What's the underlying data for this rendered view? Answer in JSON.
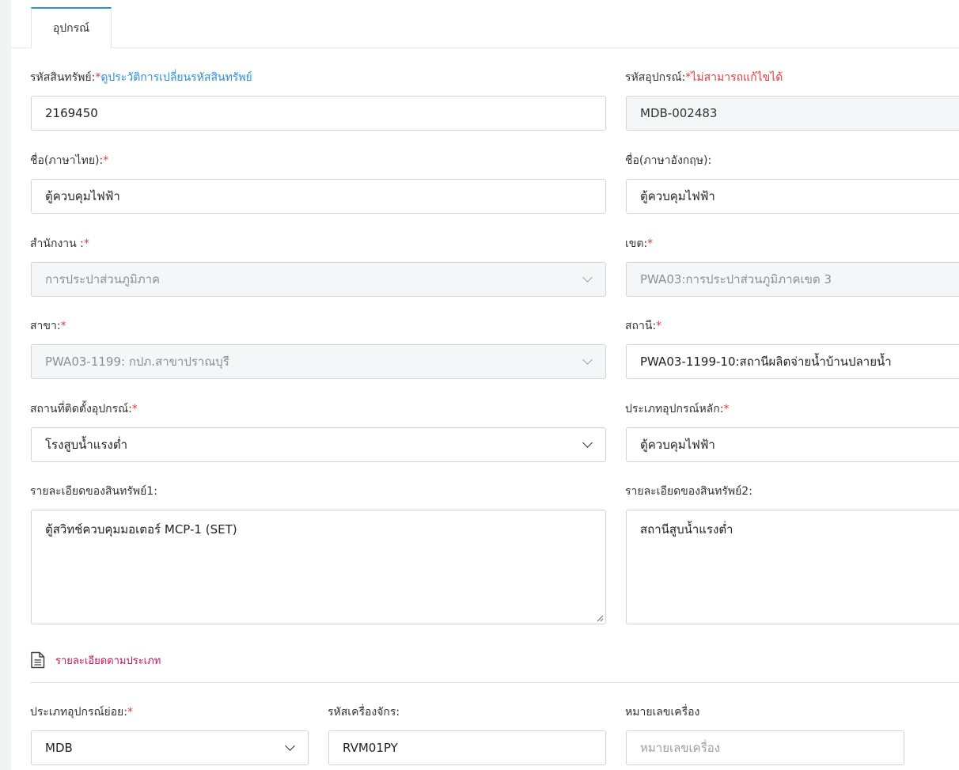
{
  "tab": {
    "label": "อุปกรณ์"
  },
  "asset_code": {
    "label": "รหัสสินทรัพย์:",
    "required_mark": "*",
    "link": "ดูประวัติการเปลี่ยนรหัสสินทรัพย์",
    "value": "2169450"
  },
  "equipment_code": {
    "label": "รหัสอุปกรณ์:",
    "required_mark": "*",
    "note": "ไม่สามารถแก้ไขได้",
    "value": "MDB-002483"
  },
  "name_th": {
    "label": "ชื่อ(ภาษาไทย):",
    "required_mark": "*",
    "value": "ตู้ควบคุมไฟฟ้า"
  },
  "name_en": {
    "label": "ชื่อ(ภาษาอังกฤษ):",
    "value": "ตู้ควบคุมไฟฟ้า"
  },
  "office": {
    "label": "สำนักงาน :",
    "required_mark": "*",
    "value": "การประปาส่วนภูมิภาค"
  },
  "zone": {
    "label": "เขต:",
    "required_mark": "*",
    "value": "PWA03:การประปาส่วนภูมิภาคเขต 3"
  },
  "branch": {
    "label": "สาขา:",
    "required_mark": "*",
    "value": "PWA03-1199: กปภ.สาขาปราณบุรี"
  },
  "station": {
    "label": "สถานี:",
    "required_mark": "*",
    "value": "PWA03-1199-10:สถานีผลิตจ่ายน้ำบ้านปลายน้ำ"
  },
  "install_location": {
    "label": "สถานที่ติดตั้งอุปกรณ์:",
    "required_mark": "*",
    "value": "โรงสูบน้ำแรงต่ำ"
  },
  "main_type": {
    "label": "ประเภทอุปกรณ์หลัก:",
    "required_mark": "*",
    "value": "ตู้ควบคุมไฟฟ้า"
  },
  "detail1": {
    "label": "รายละเอียดของสินทรัพย์1:",
    "value": "ตู้สวิทช์ควบคุมมอเตอร์ MCP-1 (SET)"
  },
  "detail2": {
    "label": "รายละเอียดของสินทรัพย์2:",
    "value": "สถานีสูบน้ำแรงต่ำ"
  },
  "section": {
    "title": "รายละเอียดตามประเภท",
    "icon": "document-icon"
  },
  "sub_type": {
    "label": "ประเภทอุปกรณ์ย่อย:",
    "required_mark": "*",
    "value": "MDB"
  },
  "machine_code": {
    "label": "รหัสเครื่องจักร:",
    "value": "RVM01PY"
  },
  "machine_no": {
    "label": "หมายเลขเครื่อง",
    "placeholder": "หมายเลขเครื่อง"
  },
  "colors": {
    "accent": "#2e8fd6",
    "required": "#e23b3b",
    "section": "#c2185b"
  }
}
